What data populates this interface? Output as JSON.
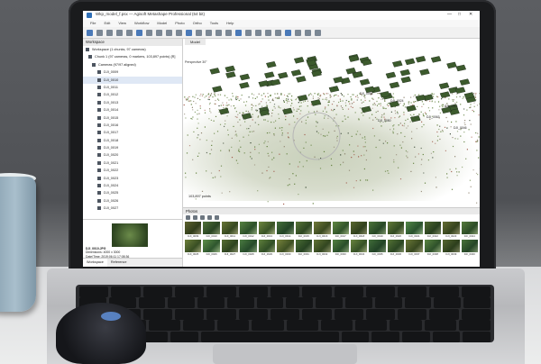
{
  "app": {
    "title": "Wkp_model_f.psx — Agisoft Metashape Professional (64 bit)",
    "window_controls": [
      "—",
      "□",
      "✕"
    ]
  },
  "menu": [
    "File",
    "Edit",
    "View",
    "Workflow",
    "Model",
    "Photo",
    "Ortho",
    "Tools",
    "Help"
  ],
  "workspace": {
    "title": "Workspace",
    "tree": [
      {
        "label": "Workspace (1 chunks, 97 cameras)",
        "selected": false,
        "icon": "folder-icon"
      },
      {
        "label": "Chunk 1 (97 cameras, 0 markers, 103,897 points) [R]",
        "selected": false,
        "icon": "chunk-icon"
      },
      {
        "label": "Cameras (97/97 aligned)",
        "selected": false,
        "icon": "camera-folder-icon"
      },
      {
        "label": "DJI_0009",
        "selected": false,
        "icon": "camera-icon"
      },
      {
        "label": "DJI_0010",
        "selected": true,
        "icon": "camera-icon"
      },
      {
        "label": "DJI_0011",
        "selected": false,
        "icon": "camera-icon"
      },
      {
        "label": "DJI_0012",
        "selected": false,
        "icon": "camera-icon"
      },
      {
        "label": "DJI_0013",
        "selected": false,
        "icon": "camera-icon"
      },
      {
        "label": "DJI_0014",
        "selected": false,
        "icon": "camera-icon"
      },
      {
        "label": "DJI_0015",
        "selected": false,
        "icon": "camera-icon"
      },
      {
        "label": "DJI_0016",
        "selected": false,
        "icon": "camera-icon"
      },
      {
        "label": "DJI_0017",
        "selected": false,
        "icon": "camera-icon"
      },
      {
        "label": "DJI_0018",
        "selected": false,
        "icon": "camera-icon"
      },
      {
        "label": "DJI_0019",
        "selected": false,
        "icon": "camera-icon"
      },
      {
        "label": "DJI_0020",
        "selected": false,
        "icon": "camera-icon"
      },
      {
        "label": "DJI_0021",
        "selected": false,
        "icon": "camera-icon"
      },
      {
        "label": "DJI_0022",
        "selected": false,
        "icon": "camera-icon"
      },
      {
        "label": "DJI_0023",
        "selected": false,
        "icon": "camera-icon"
      },
      {
        "label": "DJI_0024",
        "selected": false,
        "icon": "camera-icon"
      },
      {
        "label": "DJI_0025",
        "selected": false,
        "icon": "camera-icon"
      },
      {
        "label": "DJI_0026",
        "selected": false,
        "icon": "camera-icon"
      },
      {
        "label": "DJI_0027",
        "selected": false,
        "icon": "camera-icon"
      }
    ],
    "preview": {
      "name": "DJI_0010.JPG",
      "dimensions": "Dimensions: 4000 x 3000",
      "datetime": "Date/Time: 2019:06:11 17:08:36"
    },
    "tabs": [
      "Workspace",
      "Reference"
    ]
  },
  "model": {
    "tab": "Model",
    "view_mode": "Perspective 30°",
    "point_count": "103,897 points",
    "camera_labels": [
      "DJI_0094",
      "DJI_0024",
      "DJI_0014",
      "DJI_0063",
      "DJI_0050",
      "DJI_0046"
    ]
  },
  "photos": {
    "title": "Photos",
    "items": [
      "DJI_0009",
      "DJI_0010",
      "DJI_0011",
      "DJI_0012",
      "DJI_0013",
      "DJI_0014",
      "DJI_0015",
      "DJI_0016",
      "DJI_0017",
      "DJI_0018",
      "DJI_0019",
      "DJI_0020",
      "DJI_0021",
      "DJI_0022",
      "DJI_0023",
      "DJI_0024",
      "DJI_0025",
      "DJI_0026",
      "DJI_0027",
      "DJI_0028",
      "DJI_0029",
      "DJI_0030",
      "DJI_0031",
      "DJI_0032",
      "DJI_0033",
      "DJI_0034",
      "DJI_0035",
      "DJI_0036",
      "DJI_0037",
      "DJI_0038",
      "DJI_0039",
      "DJI_0040"
    ]
  },
  "colors": {
    "accent": "#4a79b8",
    "selection": "#dfe8f5",
    "cloud_green": "#5e7d39"
  }
}
